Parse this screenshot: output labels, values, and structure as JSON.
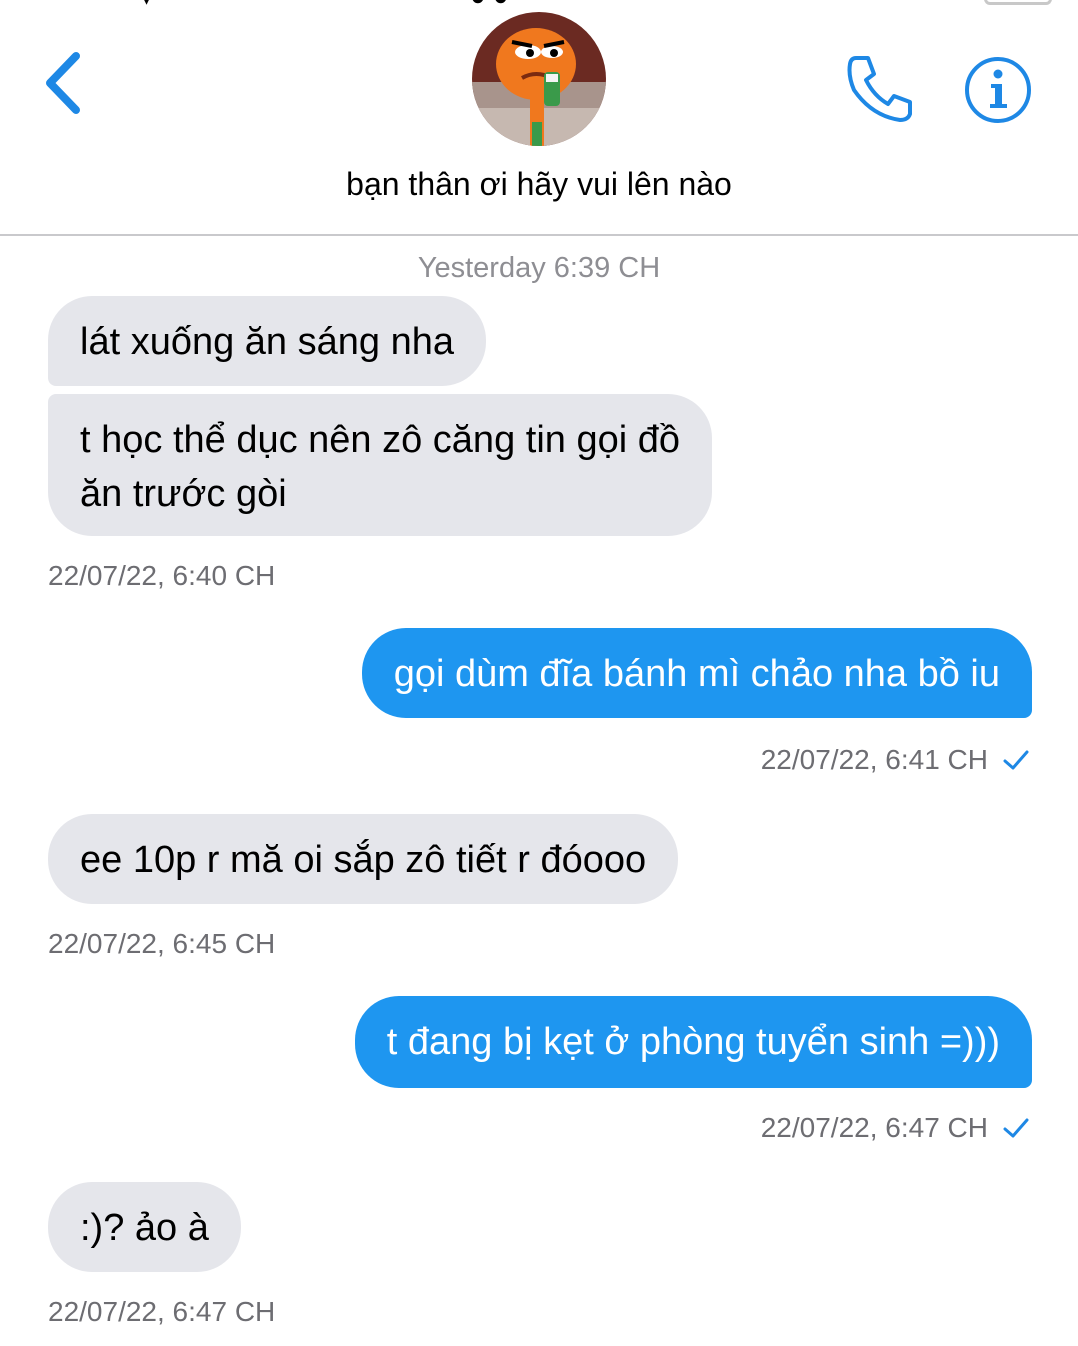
{
  "header": {
    "contact_name": "bạn thân ơi hãy vui lên nào",
    "icons": {
      "back": "chevron-left-icon",
      "call": "phone-icon",
      "info": "info-icon"
    },
    "accent_color": "#1e88e5"
  },
  "conversation": {
    "day_divider": "Yesterday 6:39 CH",
    "messages": [
      {
        "direction": "in",
        "text": "lát xuống ăn sáng nha"
      },
      {
        "direction": "in",
        "text_line1": "t học thể dục nên zô căng tin gọi đồ",
        "text_line2": "ăn trước gòi",
        "timestamp": "22/07/22, 6:40 CH"
      },
      {
        "direction": "out",
        "text": "gọi dùm đĩa bánh mì chảo nha bồ iu",
        "timestamp": "22/07/22, 6:41 CH",
        "status": "sent"
      },
      {
        "direction": "in",
        "text": "ee 10p r mă oi sắp zô tiết r đóooo",
        "timestamp": "22/07/22, 6:45 CH"
      },
      {
        "direction": "out",
        "text": "t đang bị kẹt ở phòng tuyển sinh =)))",
        "timestamp": "22/07/22, 6:47 CH",
        "status": "sent"
      },
      {
        "direction": "in",
        "text": ":)? ảo à",
        "timestamp": "22/07/22, 6:47 CH"
      }
    ]
  },
  "colors": {
    "outgoing_bubble": "#1e96f0",
    "incoming_bubble": "#e5e6eb",
    "timestamp_text": "#6d6d72"
  }
}
